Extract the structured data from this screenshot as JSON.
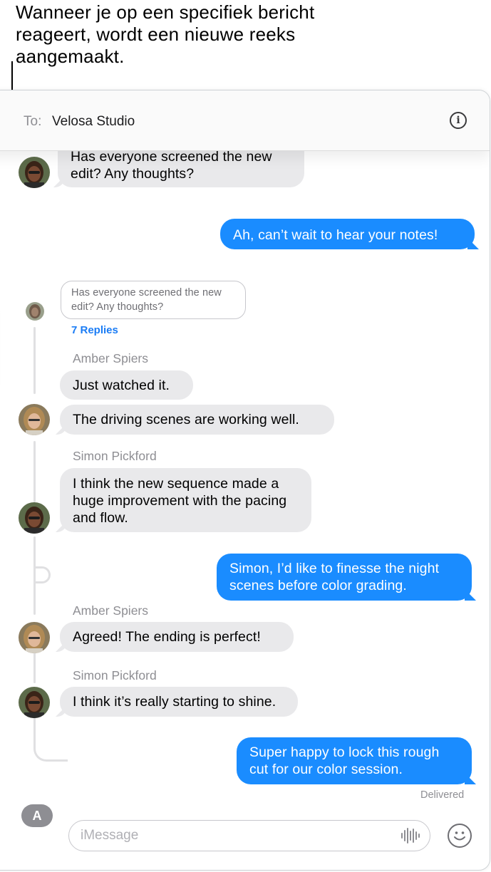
{
  "callout": {
    "text": "Wanneer je op een specifiek bericht reageert, wordt een nieuwe reeks aangemaakt."
  },
  "header": {
    "to_label": "To:",
    "recipient": "Velosa Studio",
    "info_icon": "info-icon"
  },
  "messages": {
    "top_incoming": "Has everyone screened the new edit? Any thoughts?",
    "outgoing_1": "Ah, can’t wait to hear your notes!",
    "thread_origin": "Has everyone screened the new edit? Any thoughts?",
    "replies_label": "7 Replies",
    "sender_amber_1": "Amber Spiers",
    "amber_1a": "Just watched it.",
    "amber_1b": "The driving scenes are working well.",
    "sender_simon_1": "Simon Pickford",
    "simon_1": "I think the new sequence made a huge improvement with the pacing and flow.",
    "outgoing_2": "Simon, I’d like to finesse the night scenes before color grading.",
    "sender_amber_2": "Amber Spiers",
    "amber_2": "Agreed! The ending is perfect!",
    "sender_simon_2": "Simon Pickford",
    "simon_2": "I think it’s really starting to shine.",
    "outgoing_3": "Super happy to lock this rough cut for our color session.",
    "delivered": "Delivered"
  },
  "input_bar": {
    "placeholder": "iMessage",
    "apps_icon": "app-store-icon",
    "audio_icon": "waveform-icon",
    "emoji_icon": "emoji-icon"
  },
  "colors": {
    "outgoing_bubble": "#1a8cff",
    "incoming_bubble": "#e9e9eb",
    "replies_link": "#1a7cf5"
  }
}
